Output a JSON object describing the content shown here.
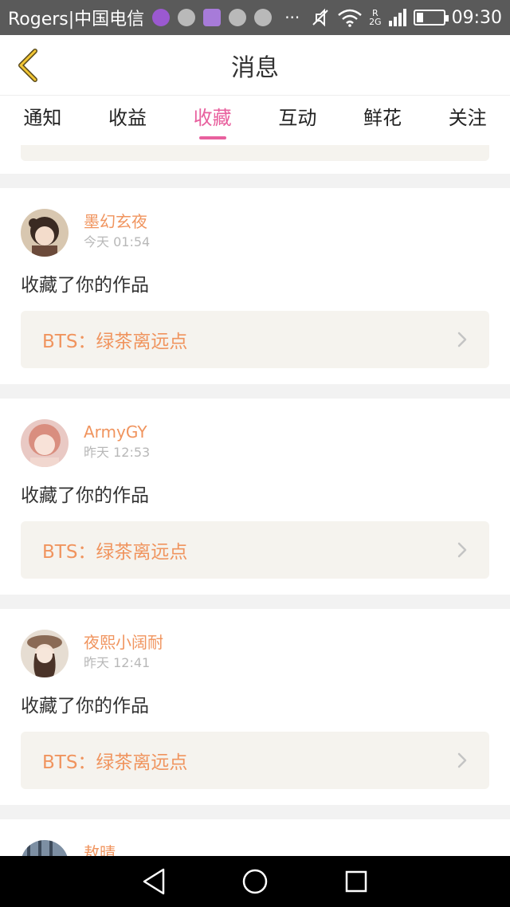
{
  "status_bar": {
    "carrier": "Rogers|中国电信",
    "more_indicator": "···",
    "network_label_top": "R",
    "network_label": "2G",
    "time": "09:30",
    "icons": [
      "notification-app-icon",
      "avatar-notification-icon",
      "gallery-notification-icon",
      "smiley-notification-icon",
      "smiley-notification-icon",
      "mute-icon",
      "wifi-icon",
      "signal-icon",
      "battery-icon"
    ]
  },
  "header": {
    "title": "消息",
    "back_icon": "chevron-left-icon"
  },
  "tabs": [
    {
      "label": "通知",
      "active": false
    },
    {
      "label": "收益",
      "active": false
    },
    {
      "label": "收藏",
      "active": true
    },
    {
      "label": "互动",
      "active": false
    },
    {
      "label": "鲜花",
      "active": false
    },
    {
      "label": "关注",
      "active": false
    }
  ],
  "accent_color": "#e8609e",
  "name_color": "#f0945e",
  "items": [
    {
      "username": "墨幻玄夜",
      "time": "今天 01:54",
      "action": "收藏了你的作品",
      "work_title": "BTS：绿茶离远点"
    },
    {
      "username": "ArmyGY",
      "time": "昨天 12:53",
      "action": "收藏了你的作品",
      "work_title": "BTS：绿茶离远点"
    },
    {
      "username": "夜熙小阔耐",
      "time": "昨天 12:41",
      "action": "收藏了你的作品",
      "work_title": "BTS：绿茶离远点"
    },
    {
      "username": "敖晴",
      "time": "",
      "action": "",
      "work_title": ""
    }
  ],
  "nav_bar": {
    "icons": [
      "back-triangle-icon",
      "home-circle-icon",
      "recents-square-icon"
    ]
  }
}
